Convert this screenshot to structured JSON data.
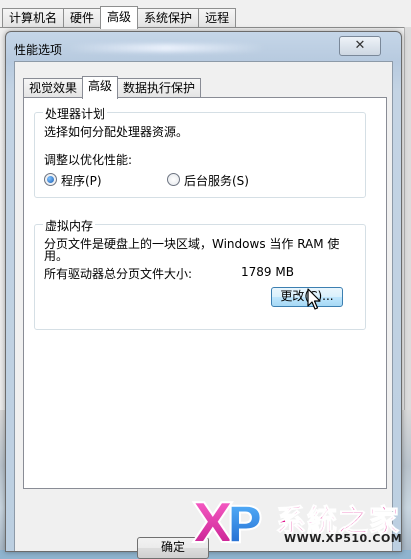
{
  "outer_window": {
    "tabs": [
      "计算机名",
      "硬件",
      "高级",
      "系统保护",
      "远程"
    ],
    "active_tab": "高级"
  },
  "dialog": {
    "title": "性能选项",
    "close_glyph": "✕",
    "tabs": [
      "视觉效果",
      "高级",
      "数据执行保护"
    ],
    "active_tab": "高级",
    "processor": {
      "legend": "处理器计划",
      "description": "选择如何分配处理器资源。",
      "adjust_label": "调整以优化性能:",
      "option_programs": "程序(P)",
      "option_services": "后台服务(S)",
      "selected": "programs"
    },
    "virtual_memory": {
      "legend": "虚拟内存",
      "description_line1": "分页文件是硬盘上的一块区域，Windows 当作 RAM 使",
      "description_line2": "用。",
      "total_label": "所有驱动器总分页文件大小:",
      "total_value": "1789 MB",
      "change_button": "更改(C)..."
    },
    "ok_button": "确定"
  },
  "watermark": {
    "logo_letters": "XP",
    "brand": "系統之家",
    "url": "WWW.XP510.COM"
  }
}
